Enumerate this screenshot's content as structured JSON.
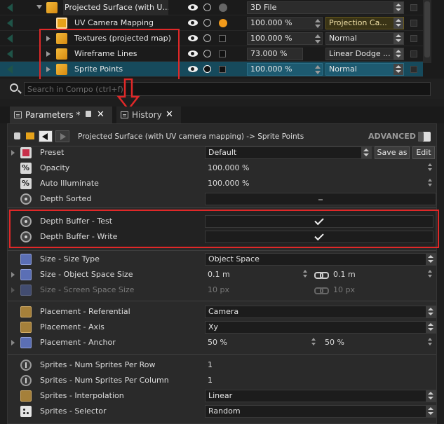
{
  "tree": {
    "rows": [
      {
        "name": "Projected Surface (with U...",
        "value": "3D File"
      },
      {
        "name": "UV Camera Mapping",
        "value": "100.000 %",
        "mode": "Projection Ca..."
      },
      {
        "name": "Textures (projected map)",
        "value": "100.000 %",
        "mode": "Normal"
      },
      {
        "name": "Wireframe Lines",
        "value": "73.000 %",
        "mode": "Linear Dodge ..."
      },
      {
        "name": "Sprite Points",
        "value": "100.000 %",
        "mode": "Normal"
      }
    ]
  },
  "search": {
    "placeholder": "Search in Compo (ctrl+f)"
  },
  "tabs": [
    {
      "label": "Parameters *"
    },
    {
      "label": "History"
    }
  ],
  "breadcrumb": {
    "path": "Projected Surface (with UV camera mapping) -> Sprite Points",
    "advanced_label": "ADVANCED"
  },
  "params": {
    "preset": {
      "label": "Preset",
      "value": "Default",
      "save_as": "Save as",
      "edit": "Edit"
    },
    "opacity": {
      "label": "Opacity",
      "value": "100.000 %"
    },
    "auto_illuminate": {
      "label": "Auto Illuminate",
      "value": "100.000 %"
    },
    "depth_sorted": {
      "label": "Depth Sorted"
    },
    "depth_test": {
      "label": "Depth Buffer - Test"
    },
    "depth_write": {
      "label": "Depth Buffer - Write"
    },
    "size_type": {
      "label": "Size - Size Type",
      "value": "Object Space"
    },
    "size_object": {
      "label": "Size - Object Space Size",
      "value1": "0.1 m",
      "value2": "0.1 m"
    },
    "size_screen": {
      "label": "Size - Screen Space Size",
      "value1": "10 px",
      "value2": "10 px"
    },
    "placement_ref": {
      "label": "Placement - Referential",
      "value": "Camera"
    },
    "placement_axis": {
      "label": "Placement - Axis",
      "value": "Xy"
    },
    "placement_anchor": {
      "label": "Placement - Anchor",
      "value1": "50 %",
      "value2": "50 %"
    },
    "sprites_row": {
      "label": "Sprites - Num Sprites Per Row",
      "value": "1"
    },
    "sprites_col": {
      "label": "Sprites - Num Sprites Per Column",
      "value": "1"
    },
    "sprites_interp": {
      "label": "Sprites - Interpolation",
      "value": "Linear"
    },
    "sprites_selector": {
      "label": "Sprites - Selector",
      "value": "Random"
    }
  },
  "colors": {
    "accent_red": "#e02828",
    "selection": "#164a5c",
    "layer_icon": "#e6a21a"
  }
}
